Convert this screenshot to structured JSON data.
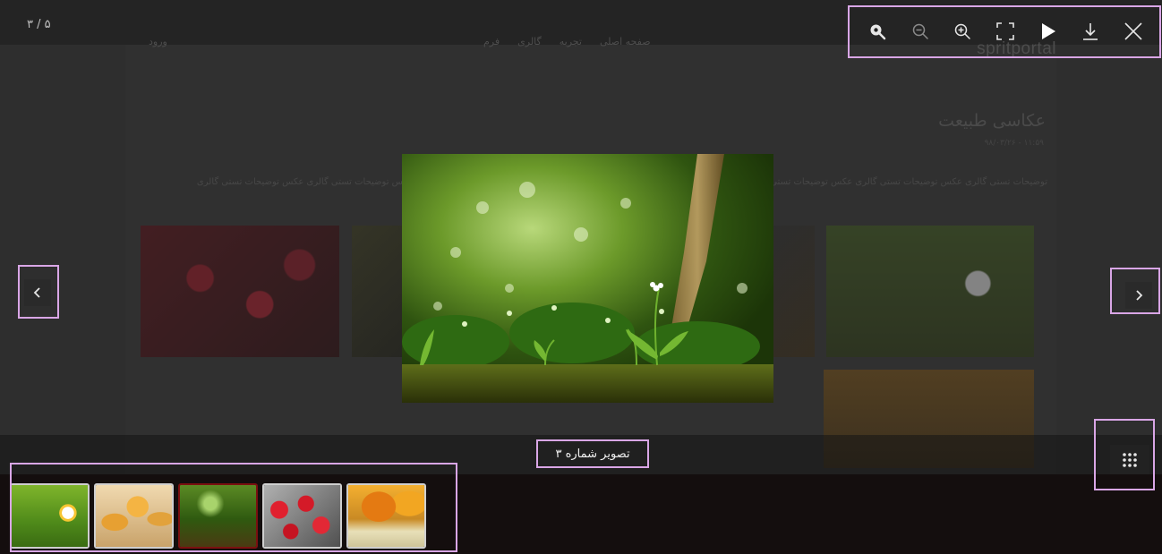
{
  "lightbox": {
    "counter": "۳ / ۵",
    "caption": "تصویر شماره ۳",
    "toolbar": {
      "actual_size": "actual-size-icon",
      "zoom_out": "zoom-out-icon",
      "zoom_in": "zoom-in-icon",
      "fullscreen": "fullscreen-icon",
      "autoplay": "play-icon",
      "download": "download-icon",
      "close": "close-icon"
    },
    "prev_icon": "chevron-left-icon",
    "next_icon": "chevron-right-icon",
    "grid_icon": "grid-icon",
    "current_index": 3,
    "total": 5,
    "thumbnails": [
      {
        "subject": "daisy"
      },
      {
        "subject": "tulips"
      },
      {
        "subject": "forest-floor"
      },
      {
        "subject": "red-flowers"
      },
      {
        "subject": "autumn-tree"
      }
    ]
  },
  "background_page": {
    "logo": "spritportal",
    "nav": [
      "صفحه اصلی",
      "تجربه",
      "گالری",
      "فرم"
    ],
    "login": "ورود",
    "title": "عکاسی طبیعت",
    "date": "۱۱:۵۹ - ۹۸/۰۳/۲۶",
    "description": "توضیحات تستی گالری عکس توضیحات تستی گالری عکس توضیحات تستی گالری عکس توضیحات تستی گالری عکس توضیحات تستی گالری عکس توضیحات تستی گالری عکس توضیحات تستی گالری عکس توضیحات تستی گالری"
  },
  "colors": {
    "overlay": "#121212",
    "active_thumb_border": "#7a1010",
    "icon": "#e6e6e6"
  }
}
